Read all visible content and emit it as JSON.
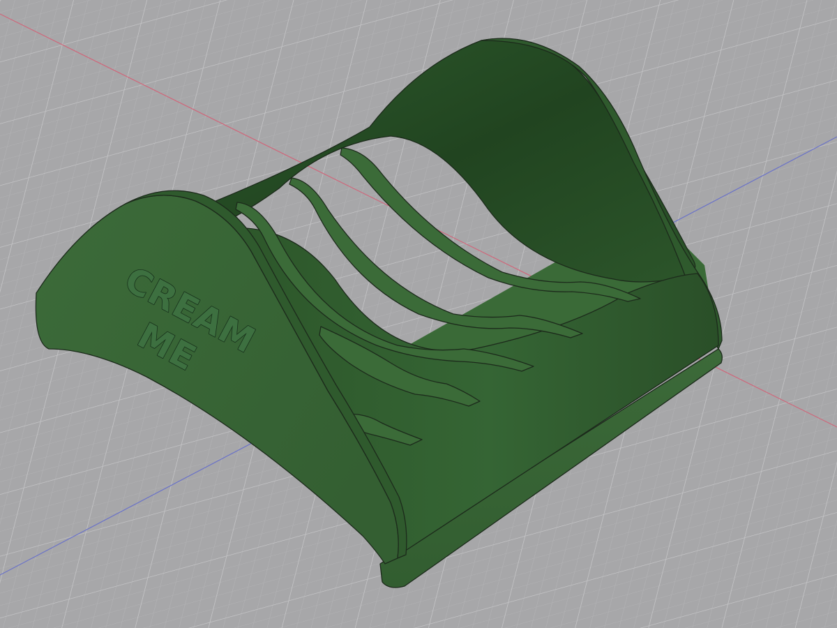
{
  "viewport": {
    "background_color": "#a7a7a9",
    "grid_minor_color": "#b2b2b4",
    "grid_major_color": "#c8c8ca",
    "axis_x_color": "#d0667a",
    "axis_y_color": "#6a72c8"
  },
  "model": {
    "color": "#3f6e3c",
    "edge_color": "#1c2a1b",
    "embossed_text": {
      "line1": "CREAM",
      "line2": "ME"
    },
    "slot_count": 4
  }
}
